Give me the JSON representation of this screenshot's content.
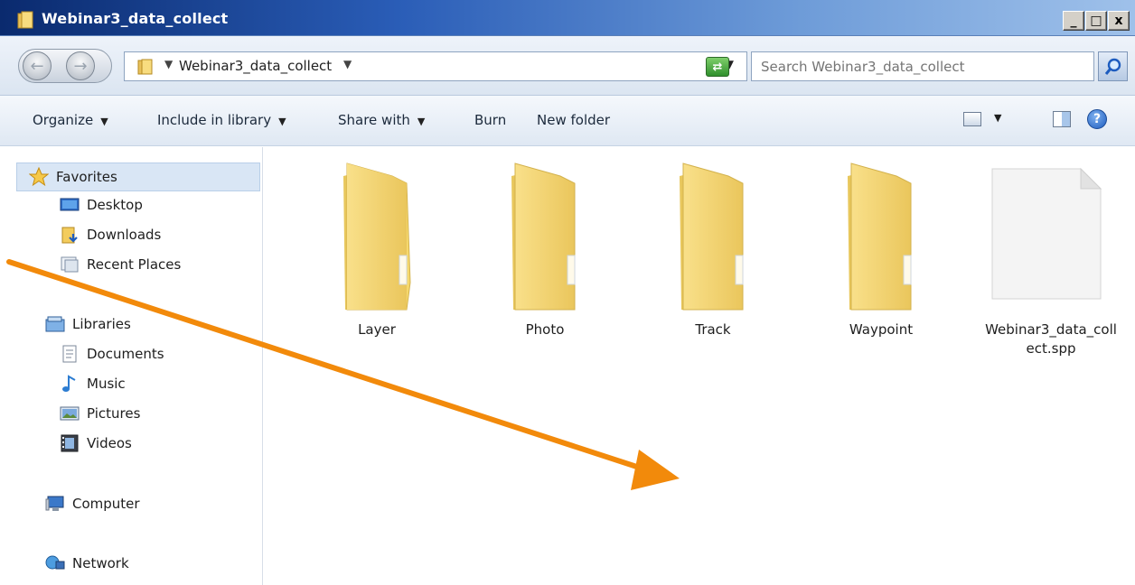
{
  "window": {
    "title": "Webinar3_data_collect",
    "buttons": [
      "_",
      "□",
      "x"
    ]
  },
  "address": {
    "breadcrumb": "Webinar3_data_collect",
    "search_placeholder": "Search Webinar3_data_collect"
  },
  "toolbar": {
    "organize": "Organize",
    "include_in_library": "Include in library",
    "share_with": "Share with",
    "burn": "Burn",
    "new_folder": "New folder"
  },
  "sidebar": {
    "favorites": {
      "label": "Favorites",
      "items": [
        "Desktop",
        "Downloads",
        "Recent Places"
      ]
    },
    "libraries": {
      "label": "Libraries",
      "items": [
        "Documents",
        "Music",
        "Pictures",
        "Videos"
      ]
    },
    "computer": "Computer",
    "network": "Network"
  },
  "files": [
    {
      "name": "Layer",
      "type": "folder"
    },
    {
      "name": "Photo",
      "type": "folder"
    },
    {
      "name": "Track",
      "type": "folder"
    },
    {
      "name": "Waypoint",
      "type": "folder"
    },
    {
      "name": "Webinar3_data_coll\nect.spp",
      "type": "file"
    }
  ],
  "overlay": {
    "arrow_color": "#f28a0b"
  },
  "colors": {
    "titlebar": "#2a5db7",
    "selection": "#d9e6f5",
    "folder": "#f6d96e"
  }
}
